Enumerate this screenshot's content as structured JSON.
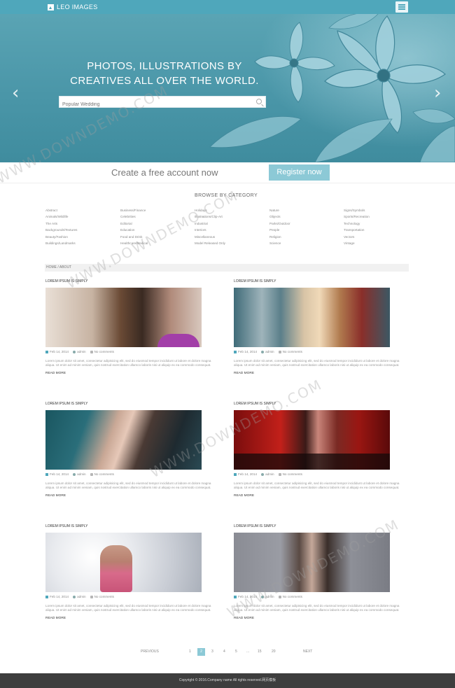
{
  "brand": {
    "name": "LEO IMAGES"
  },
  "hero": {
    "title_line1": "PHOTOS, ILLUSTRATIONS BY",
    "title_line2": "CREATIVES ALL OVER THE WORLD.",
    "search_placeholder": "Popular Wedding",
    "prev_arrow": "‹",
    "next_arrow": "›"
  },
  "cta": {
    "text": "Create a free account now",
    "button": "Register now"
  },
  "categories": {
    "title": "BROWSE BY CATEGORY",
    "columns": [
      [
        "Abstract",
        "Animals/Wildlife",
        "The Arts",
        "Backgrounds/Textures",
        "Beauty/Fashion",
        "Buildings/Landmarks"
      ],
      [
        "Business/Finance",
        "Celebrities",
        "Editorial",
        "Education",
        "Food and Drink",
        "Healthcare/Medical"
      ],
      [
        "Holidays",
        "Illustrations/Clip-Art",
        "Industrial",
        "Interiors",
        "Miscellaneous",
        "Model Released Only"
      ],
      [
        "Nature",
        "Objects",
        "Parks/Outdoor",
        "People",
        "Religion",
        "Science"
      ],
      [
        "Signs/Symbols",
        "Sports/Recreation",
        "Technology",
        "Transportation",
        "Vectors",
        "Vintage"
      ]
    ]
  },
  "breadcrumb": "HOME / ABOUT",
  "posts": [
    {
      "title": "LOREM IPSUM IS SIMPLY",
      "date": "Feb 14, 2014",
      "author": "admin",
      "comments": "No comments",
      "body": "Lorem ipsum dolor sit amet, consectetur adipisicing elit, sed do eiusmod tempor incididunt ut labore et dolore magna aliqua. Ut enim ad minim veniam, quis nostrud exercitation ullamco laboris nisi ut aliquip ex ea commodo consequat.",
      "more": "READ MORE"
    },
    {
      "title": "LOREM IPSUM IS SIMPLY",
      "date": "Feb 14, 2014",
      "author": "admin",
      "comments": "No comments",
      "body": "Lorem ipsum dolor sit amet, consectetur adipisicing elit, sed do eiusmod tempor incididunt ut labore et dolore magna aliqua. Ut enim ad minim veniam, quis nostrud exercitation ullamco laboris nisi ut aliquip ex ea commodo consequat.",
      "more": "READ MORE"
    },
    {
      "title": "LOREM IPSUM IS SIMPLY",
      "date": "Feb 14, 2014",
      "author": "admin",
      "comments": "No comments",
      "body": "Lorem ipsum dolor sit amet, consectetur adipisicing elit, sed do eiusmod tempor incididunt ut labore et dolore magna aliqua. Ut enim ad minim veniam, quis nostrud exercitation ullamco laboris nisi ut aliquip ex ea commodo consequat.",
      "more": "READ MORE"
    },
    {
      "title": "LOREM IPSUM IS SIMPLY",
      "date": "Feb 14, 2014",
      "author": "admin",
      "comments": "No comments",
      "body": "Lorem ipsum dolor sit amet, consectetur adipisicing elit, sed do eiusmod tempor incididunt ut labore et dolore magna aliqua. Ut enim ad minim veniam, quis nostrud exercitation ullamco laboris nisi ut aliquip ex ea commodo consequat.",
      "more": "READ MORE"
    },
    {
      "title": "LOREM IPSUM IS SIMPLY",
      "date": "Feb 14, 2014",
      "author": "admin",
      "comments": "No comments",
      "body": "Lorem ipsum dolor sit amet, consectetur adipisicing elit, sed do eiusmod tempor incididunt ut labore et dolore magna aliqua. Ut enim ad minim veniam, quis nostrud exercitation ullamco laboris nisi ut aliquip ex ea commodo consequat.",
      "more": "READ MORE"
    },
    {
      "title": "LOREM IPSUM IS SIMPLY",
      "date": "Feb 14, 2014",
      "author": "admin",
      "comments": "No comments",
      "body": "Lorem ipsum dolor sit amet, consectetur adipisicing elit, sed do eiusmod tempor incididunt ut labore et dolore magna aliqua. Ut enim ad minim veniam, quis nostrud exercitation ullamco laboris nisi ut aliquip ex ea commodo consequat.",
      "more": "READ MORE"
    }
  ],
  "pagination": {
    "previous": "PREVIOUS",
    "pages": [
      "1",
      "2",
      "3",
      "4",
      "5",
      "...",
      "15",
      "20"
    ],
    "current": "2",
    "next": "NEXT"
  },
  "footer": {
    "text": "Copyright © 2016.Company name All rights reserved.网页模板"
  },
  "watermark": "WWW.DOWNDEMO.COM",
  "colors": {
    "accent": "#4fa7bb",
    "button": "#8cc9d6",
    "footer": "#3e3e3e"
  }
}
